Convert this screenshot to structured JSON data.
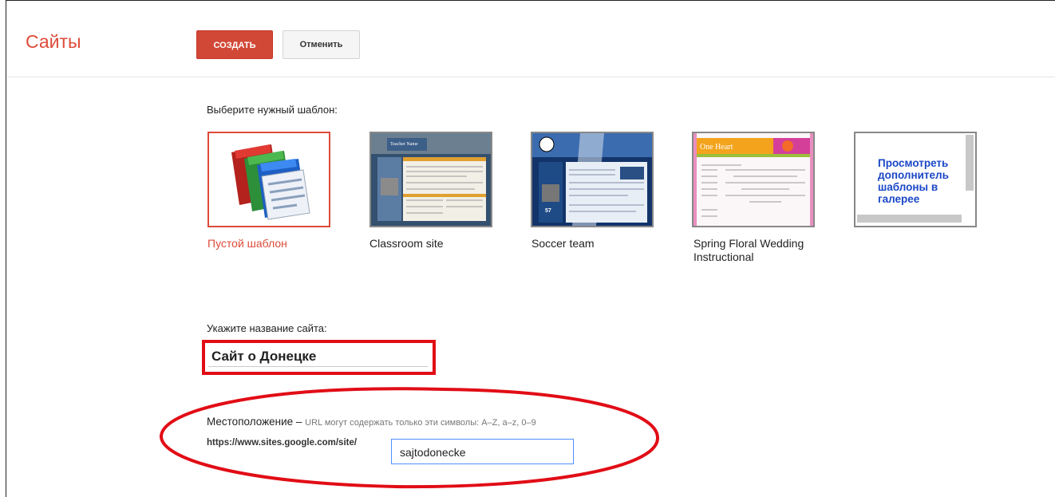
{
  "header": {
    "app_title": "Сайты",
    "create_label": "СОЗДАТЬ",
    "cancel_label": "Отменить"
  },
  "templates": {
    "section_label": "Выберите нужный шаблон:",
    "items": [
      {
        "name": "Пустой шаблон",
        "selected": true,
        "icon": "google-sites-icon"
      },
      {
        "name": "Classroom site"
      },
      {
        "name": "Soccer team"
      },
      {
        "name": "Spring Floral Wedding Instructional"
      }
    ],
    "more_link": "Просмотреть дополнитель шаблоны в галерее",
    "thumbnails": {
      "classroom_banner": "Teacher Name",
      "soccer_number": "57",
      "floral_banner": "One Heart"
    }
  },
  "site_name": {
    "label": "Укажите название сайта:",
    "value": "Сайт о Донецке"
  },
  "location": {
    "label": "Местоположение",
    "dash": " – ",
    "hint": "URL могут содержать только эти символы: A–Z, a–z, 0–9",
    "url_prefix": "https://www.sites.google.com/site/",
    "value": "sajtodonecke"
  },
  "colors": {
    "accent": "#dd4b39",
    "annotation_red": "#e10d16",
    "link_blue": "#1a47c6",
    "focus_blue": "#4d90fe"
  }
}
